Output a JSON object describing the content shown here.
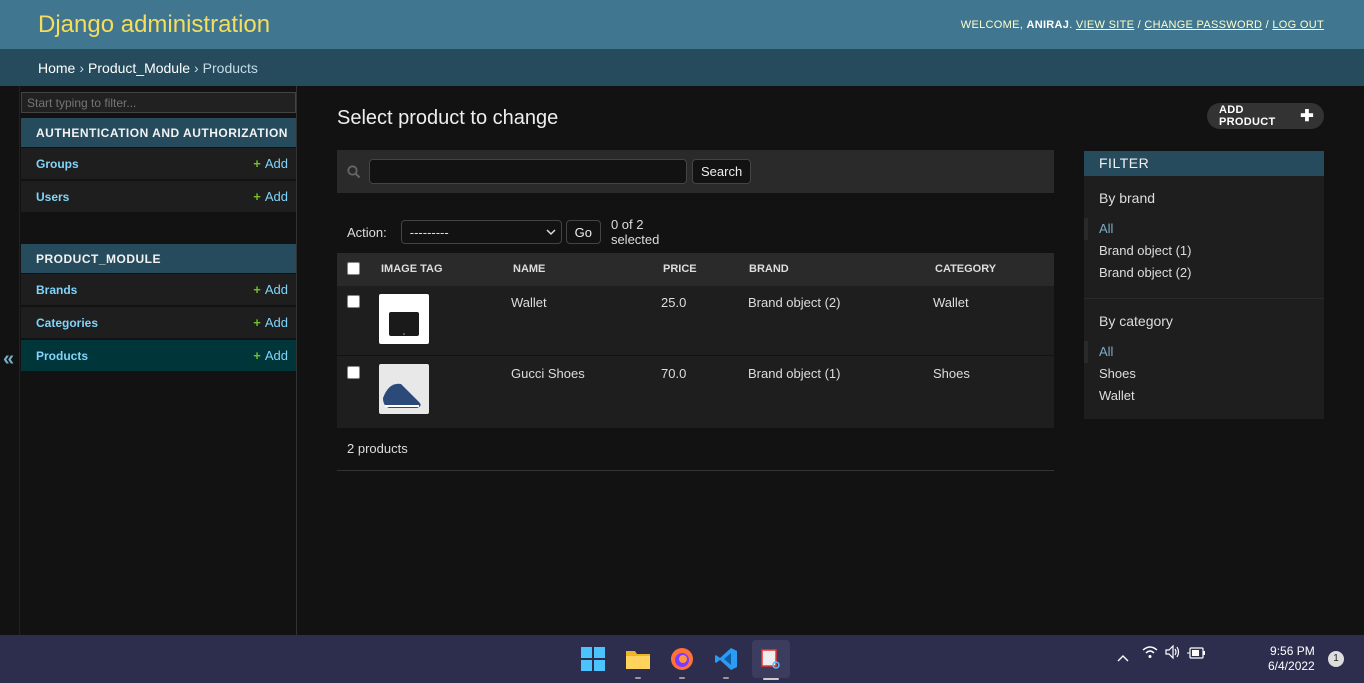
{
  "header": {
    "branding": "Django administration",
    "welcome": "WELCOME,",
    "username": "ANIRAJ",
    "view_site": "VIEW SITE",
    "change_password": "CHANGE PASSWORD",
    "log_out": "LOG OUT"
  },
  "breadcrumbs": {
    "home": "Home",
    "module": "Product_Module",
    "current": "Products"
  },
  "sidebar": {
    "filter_placeholder": "Start typing to filter...",
    "toggle": "«",
    "auth_caption": "AUTHENTICATION AND AUTHORIZATION",
    "auth_items": [
      {
        "label": "Groups",
        "add": "Add"
      },
      {
        "label": "Users",
        "add": "Add"
      }
    ],
    "product_caption": "PRODUCT_MODULE",
    "product_items": [
      {
        "label": "Brands",
        "add": "Add"
      },
      {
        "label": "Categories",
        "add": "Add"
      },
      {
        "label": "Products",
        "add": "Add"
      }
    ]
  },
  "main": {
    "title": "Select product to change",
    "add_button": "ADD PRODUCT",
    "search_button": "Search",
    "action_label": "Action:",
    "action_value": "---------",
    "go_button": "Go",
    "counter": "0 of 2 selected",
    "columns": [
      "IMAGE TAG",
      "NAME",
      "PRICE",
      "BRAND",
      "CATEGORY"
    ],
    "rows": [
      {
        "name": "Wallet",
        "price": "25.0",
        "brand": "Brand object (2)",
        "category": "Wallet"
      },
      {
        "name": "Gucci Shoes",
        "price": "70.0",
        "brand": "Brand object (1)",
        "category": "Shoes"
      }
    ],
    "footer": "2 products"
  },
  "filter": {
    "title": "FILTER",
    "by_brand": "By brand",
    "brand_options": [
      "All",
      "Brand object (1)",
      "Brand object (2)"
    ],
    "by_category": "By category",
    "category_options": [
      "All",
      "Shoes",
      "Wallet"
    ]
  },
  "taskbar": {
    "time": "9:56 PM",
    "date": "6/4/2022",
    "notifications": "1"
  },
  "colors": {
    "header": "#417690",
    "breadcrumbs": "#264b5d",
    "branding": "#f5dd5d",
    "link": "#81d4fa",
    "add": "#70bf2b"
  }
}
